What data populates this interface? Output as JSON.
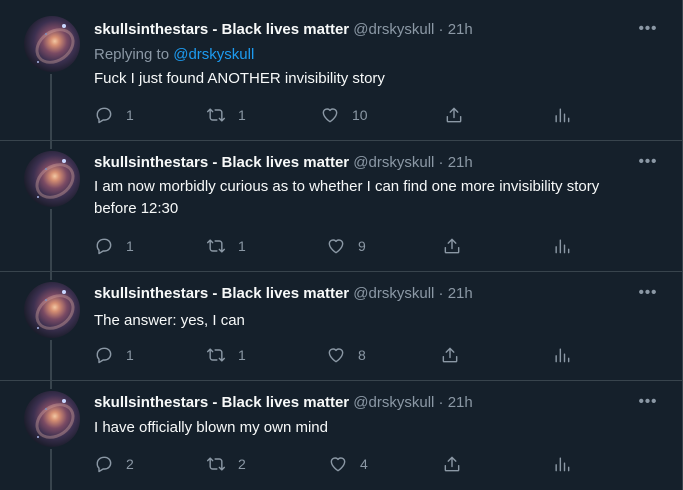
{
  "tweets": [
    {
      "display_name": "skullsinthestars - Black lives matter",
      "handle": "@drskyskull",
      "dot": "·",
      "time": "21h",
      "replying_label": "Replying to ",
      "replying_to": "@drskyskull",
      "text": "Fuck I just found ANOTHER invisibility story",
      "replies": "1",
      "retweets": "1",
      "likes": "10"
    },
    {
      "display_name": "skullsinthestars - Black lives matter",
      "handle": "@drskyskull",
      "dot": "·",
      "time": "21h",
      "text": "I am now morbidly curious as to whether I can find one more invisibility story before 12:30",
      "replies": "1",
      "retweets": "1",
      "likes": "9"
    },
    {
      "display_name": "skullsinthestars - Black lives matter",
      "handle": "@drskyskull",
      "dot": "·",
      "time": "21h",
      "text": "The answer: yes, I can",
      "replies": "1",
      "retweets": "1",
      "likes": "8"
    },
    {
      "display_name": "skullsinthestars - Black lives matter",
      "handle": "@drskyskull",
      "dot": "·",
      "time": "21h",
      "text": "I have officially blown my own mind",
      "replies": "2",
      "retweets": "2",
      "likes": "4"
    }
  ],
  "more_glyph": "•••",
  "icons": [
    "reply-icon",
    "retweet-icon",
    "like-icon",
    "share-icon",
    "analytics-icon",
    "more-icon"
  ],
  "colors": {
    "background": "#15202b",
    "border": "#38444d",
    "text": "#f7f9f9",
    "muted": "#8b98a5",
    "link": "#1d9bf0"
  }
}
